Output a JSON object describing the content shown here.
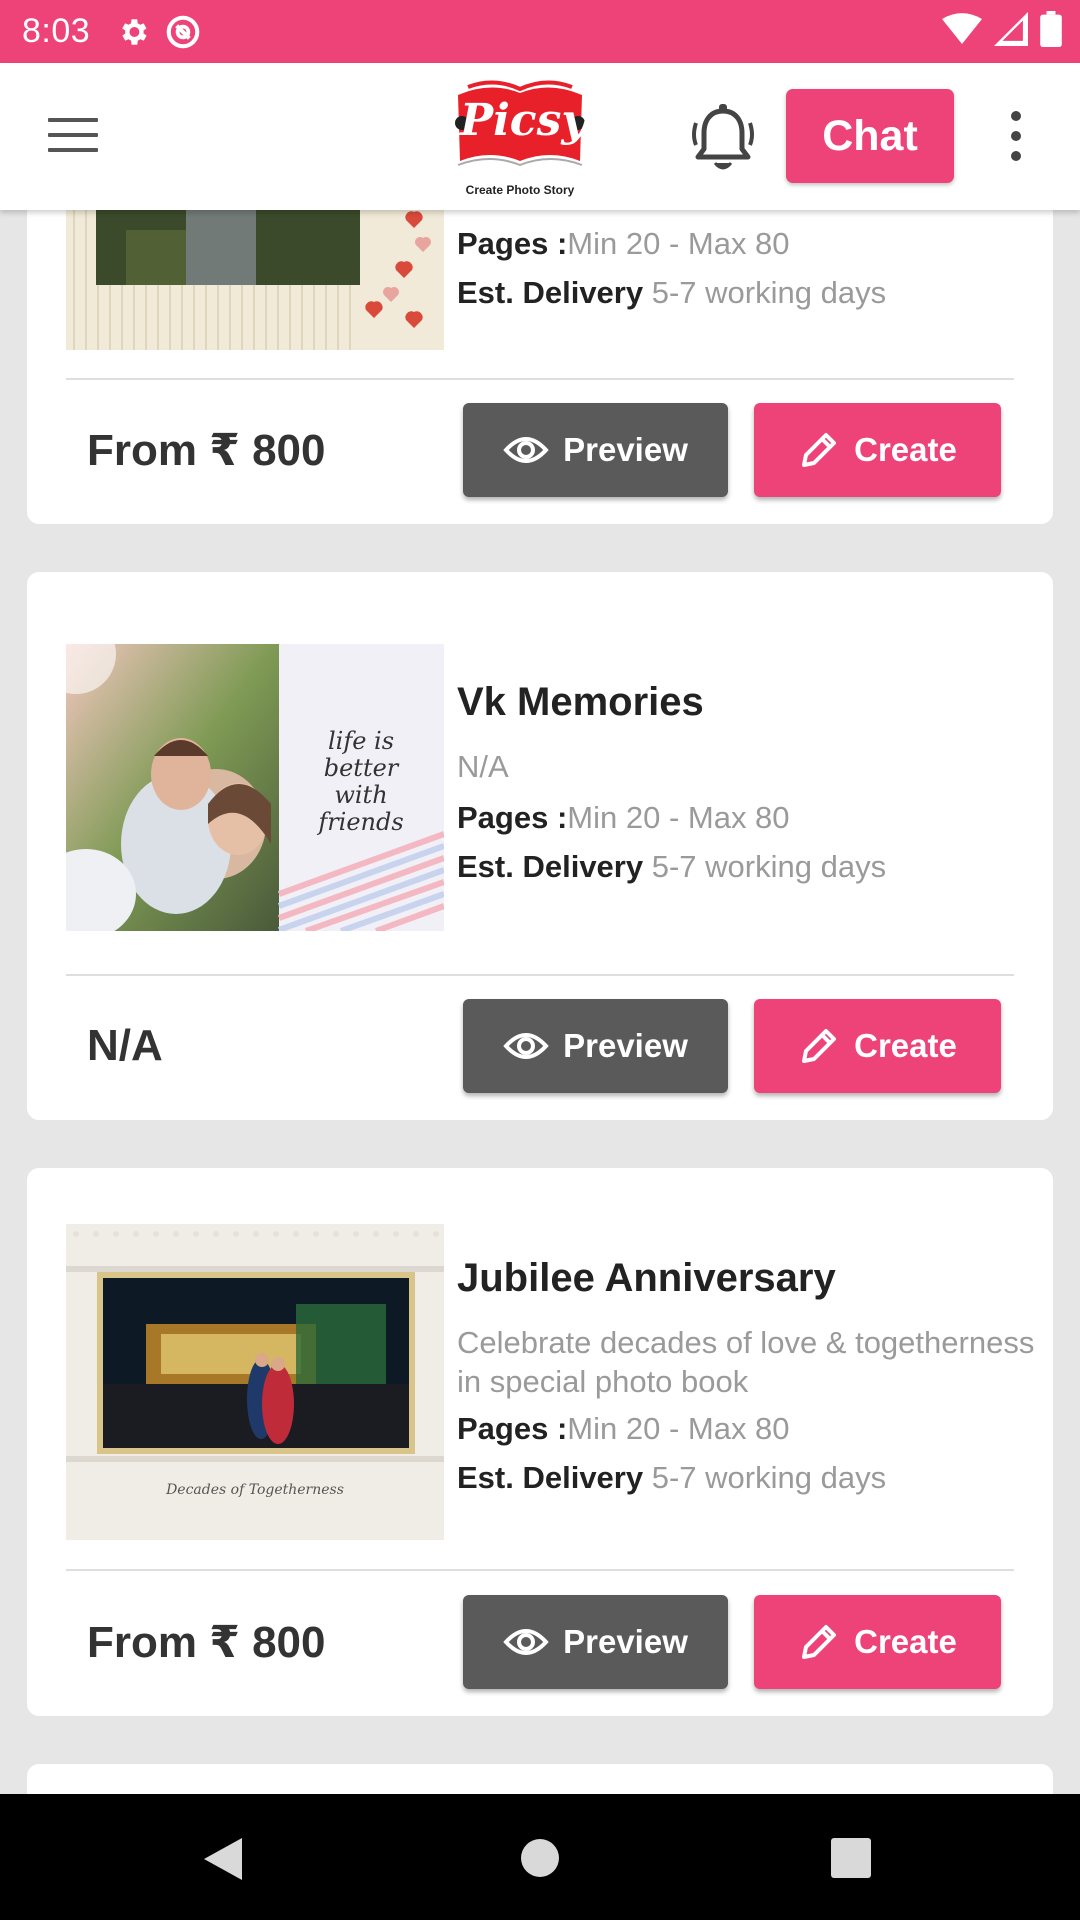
{
  "status_bar": {
    "time": "8:03",
    "icons": [
      "gear-icon",
      "sync-icon",
      "wifi-icon",
      "signal-icon",
      "battery-icon"
    ]
  },
  "app_bar": {
    "logo_text": "Picsy",
    "logo_tagline": "Create Photo Story",
    "chat_label": "Chat",
    "icons": [
      "menu-icon",
      "bell-icon",
      "more-vert-icon"
    ]
  },
  "colors": {
    "accent": "#ee4379",
    "preview_button": "#5a5a5a",
    "muted_text": "#9a9a9a",
    "background": "#e6e6e6"
  },
  "cards": [
    {
      "title": "",
      "description": "",
      "pages_label": "Pages :",
      "pages_value": "Min 20 - Max 80",
      "delivery_label": "Est. Delivery",
      "delivery_value": "5-7 working days",
      "price": "From ₹ 800",
      "preview_label": "Preview",
      "create_label": "Create"
    },
    {
      "title": "Vk Memories",
      "description": "N/A",
      "thumb_text": "life is better with friends",
      "pages_label": "Pages :",
      "pages_value": "Min 20 - Max 80",
      "delivery_label": "Est. Delivery",
      "delivery_value": "5-7 working days",
      "price": "N/A",
      "preview_label": "Preview",
      "create_label": "Create"
    },
    {
      "title": "Jubilee Anniversary",
      "description": "Celebrate decades of love & togetherness in special photo book",
      "thumb_text": "Decades of Togetherness",
      "pages_label": "Pages :",
      "pages_value": "Min 20 - Max 80",
      "delivery_label": "Est. Delivery",
      "delivery_value": "5-7 working days",
      "price": "From ₹ 800",
      "preview_label": "Preview",
      "create_label": "Create"
    }
  ],
  "nav_bar": {
    "icons": [
      "back-icon",
      "home-icon",
      "recents-icon"
    ]
  }
}
